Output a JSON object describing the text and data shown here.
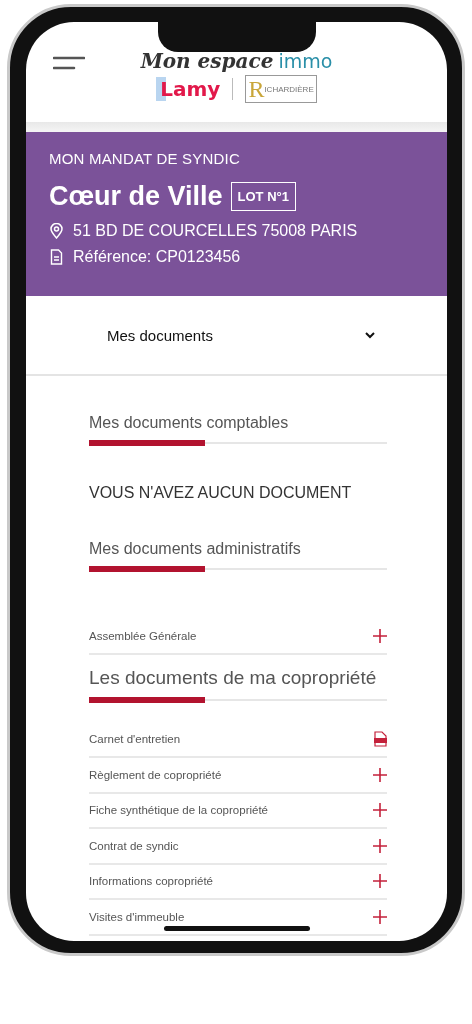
{
  "logo": {
    "title": "Mon espace",
    "accent": "immo",
    "brand": "Lamy",
    "partner_initial": "R",
    "partner_rest": "ICHARDIÈRE"
  },
  "mandate": {
    "label": "MON MANDAT DE SYNDIC",
    "name": "Cœur de Ville",
    "lot": "LOT N°1",
    "address": "51 BD DE COURCELLES 75008 PARIS",
    "reference": "Référence: CP0123456"
  },
  "dropdown": {
    "label": "Mes documents"
  },
  "sections": [
    {
      "title": "Mes documents comptables",
      "empty_message": "VOUS N'AVEZ AUCUN DOCUMENT"
    },
    {
      "title": "Mes documents administratifs",
      "items": [
        {
          "label": "Assemblée Générale",
          "kind": "expand"
        }
      ]
    },
    {
      "title": "Les documents de ma copropriété",
      "large": true,
      "items": [
        {
          "label": "Carnet d'entretien",
          "kind": "pdf"
        },
        {
          "label": "Règlement de copropriété",
          "kind": "expand"
        },
        {
          "label": "Fiche synthétique de la copropriété",
          "kind": "expand"
        },
        {
          "label": "Contrat de syndic",
          "kind": "expand"
        },
        {
          "label": "Informations copropriété",
          "kind": "expand"
        },
        {
          "label": "Visites d'immeuble",
          "kind": "expand"
        }
      ]
    }
  ]
}
